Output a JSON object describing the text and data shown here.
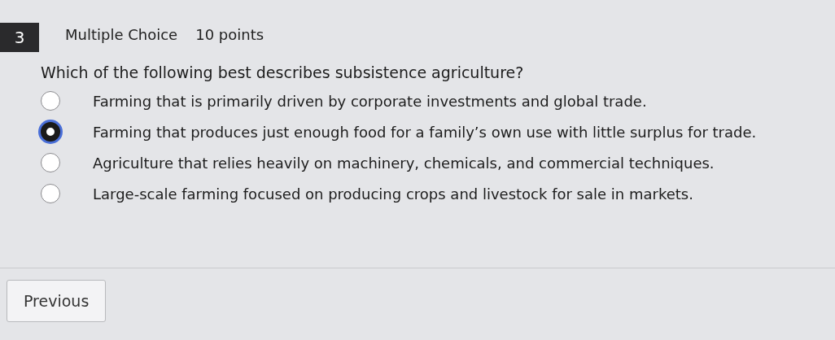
{
  "question": {
    "number": "3",
    "type": "Multiple Choice",
    "points": "10 points",
    "prompt": "Which of the following best describes subsistence agriculture?"
  },
  "options": [
    {
      "label": "Farming that is primarily driven by corporate investments and global trade.",
      "selected": false
    },
    {
      "label": "Farming that produces just enough food for a family’s own use with little surplus for trade.",
      "selected": true
    },
    {
      "label": "Agriculture that relies heavily on machinery, chemicals, and commercial techniques.",
      "selected": false
    },
    {
      "label": "Large-scale farming focused on producing crops and livestock for sale in markets.",
      "selected": false
    }
  ],
  "buttons": [
    {
      "label": "Previous"
    }
  ]
}
